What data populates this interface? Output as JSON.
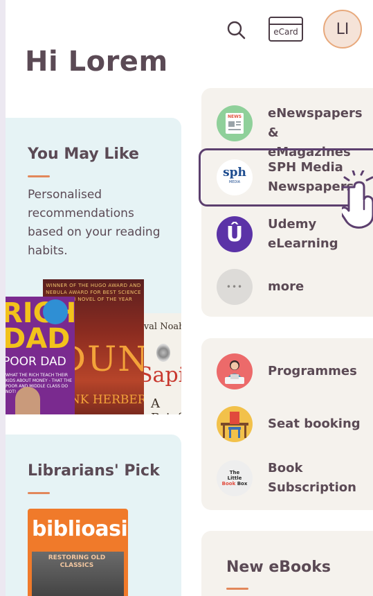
{
  "header": {
    "ecard_label": "eCard",
    "avatar_initials": "LI",
    "greeting": "Hi Lorem"
  },
  "you_may_like": {
    "title": "You May Like",
    "description": "Personalised recommendations based on your reading habits.",
    "books": [
      {
        "top": "RICH",
        "mid": "DAD",
        "bottom": "POOR DAD",
        "note": "WHAT THE RICH TEACH THEIR KIDS ABOUT MONEY - THAT THE POOR AND MIDDLE CLASS DO NOT!"
      },
      {
        "banner": "WINNER OF THE HUGO AWARD AND NEBULA AWARD FOR BEST SCIENCE FICTION NOVEL OF THE YEAR",
        "title": "DUNE",
        "author": "FRANK HERBERT"
      },
      {
        "author": "Yuval Noah Harari",
        "title": "Sapiens",
        "subtitle": "A Brief"
      }
    ]
  },
  "librarians_pick": {
    "title": "Librarians' Pick",
    "book": {
      "title": "biblioasia",
      "headline": "RESTORING OLD CLASSICS"
    }
  },
  "eresources": {
    "items": [
      {
        "label": "eNewspapers & eMagazines",
        "icon_text": "NEWS"
      },
      {
        "label": "SPH Media Newspapers",
        "icon_text": "sph",
        "icon_sub": "MEDIA"
      },
      {
        "label": "Udemy eLearning",
        "icon_text": "Û"
      },
      {
        "label": "more",
        "icon_text": "•••"
      }
    ]
  },
  "services": {
    "items": [
      {
        "label": "Programmes"
      },
      {
        "label": "Seat booking"
      },
      {
        "label": "Book Subscription",
        "icon_line1": "The",
        "icon_line2": "Little",
        "icon_line3": "Book",
        "icon_line4": "Box"
      }
    ]
  },
  "new_ebooks": {
    "title": "New eBooks"
  },
  "colors": {
    "accent": "#e2875a",
    "highlight": "#5c3f6e",
    "text": "#5b4a55"
  }
}
